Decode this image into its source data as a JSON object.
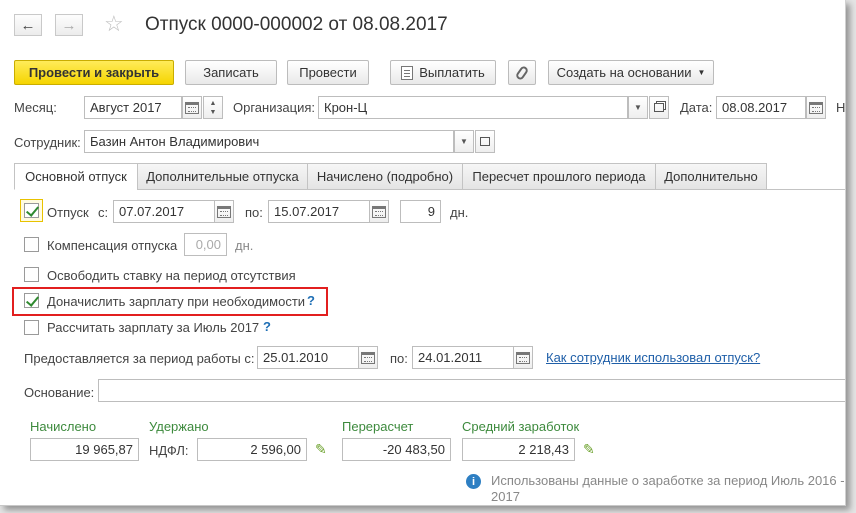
{
  "window": {
    "title": "Отпуск 0000-000002 от 08.08.2017",
    "back_glyph": "←",
    "forward_glyph": "→",
    "star_glyph": "☆"
  },
  "toolbar": {
    "post_close": "Провести и закрыть",
    "save": "Записать",
    "post": "Провести",
    "pay": "Выплатить",
    "create_based": "Создать на основании"
  },
  "header": {
    "month_label": "Месяц:",
    "month_value": "Август 2017",
    "org_label": "Организация:",
    "org_value": "Крон-Ц",
    "date_label": "Дата:",
    "date_value": "08.08.2017",
    "number_label_partial": "Н",
    "employee_label": "Сотрудник:",
    "employee_value": "Базин Антон Владимирович"
  },
  "tabs": [
    {
      "label": "Основной отпуск",
      "active": true
    },
    {
      "label": "Дополнительные отпуска",
      "active": false
    },
    {
      "label": "Начислено (подробно)",
      "active": false
    },
    {
      "label": "Пересчет прошлого периода",
      "active": false
    },
    {
      "label": "Дополнительно",
      "active": false
    }
  ],
  "main": {
    "vacation_label": "Отпуск",
    "vacation_checked": true,
    "from_label": "с:",
    "from_value": "07.07.2017",
    "to_label": "по:",
    "to_value": "15.07.2017",
    "days_value": "9",
    "days_unit": "дн.",
    "compensation_label": "Компенсация отпуска",
    "compensation_checked": false,
    "compensation_value": "0,00",
    "compensation_unit": "дн.",
    "release_rate_label": "Освободить ставку на период отсутствия",
    "release_rate_checked": false,
    "accrue_label": "Доначислить зарплату при необходимости",
    "accrue_checked": true,
    "accrue_help": "?",
    "calc_salary_label": "Рассчитать зарплату за Июль 2017",
    "calc_salary_checked": false,
    "calc_salary_help": "?",
    "period_label": "Предоставляется за период работы с:",
    "period_from": "25.01.2010",
    "period_to_label": "по:",
    "period_to": "24.01.2011",
    "usage_link": "Как сотрудник использовал отпуск?",
    "basis_label": "Основание:",
    "basis_value": ""
  },
  "totals": {
    "accrued_label": "Начислено",
    "accrued_value": "19 965,87",
    "withheld_label": "Удержано",
    "ndfl_label": "НДФЛ:",
    "ndfl_value": "2 596,00",
    "recalc_label": "Перерасчет",
    "recalc_value": "-20 483,50",
    "avg_label": "Средний заработок",
    "avg_value": "2 218,43",
    "info_line1": "Использованы данные о заработке за период Июль 2016 -",
    "info_line2": "2017"
  },
  "colors": {
    "primary_button": "#f5d400",
    "highlight_border": "#e21f1f",
    "link": "#1f5fa8",
    "green_label": "#3d8a3d"
  }
}
